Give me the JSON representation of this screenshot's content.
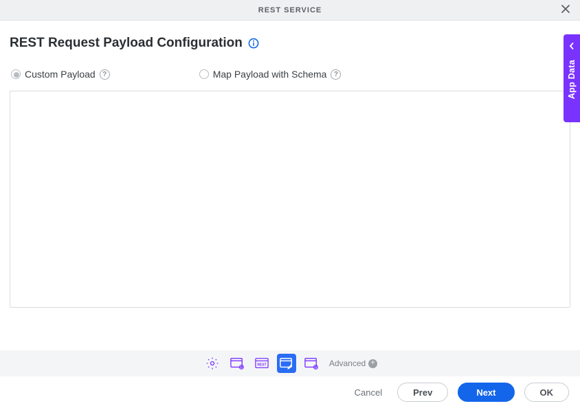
{
  "header": {
    "title": "REST SERVICE"
  },
  "page": {
    "title": "REST Request Payload Configuration"
  },
  "options": {
    "custom": "Custom Payload",
    "mapSchema": "Map Payload with Schema"
  },
  "sideTab": {
    "label": "App Data"
  },
  "stepper": {
    "advanced": "Advanced"
  },
  "buttons": {
    "cancel": "Cancel",
    "prev": "Prev",
    "next": "Next",
    "ok": "OK"
  }
}
